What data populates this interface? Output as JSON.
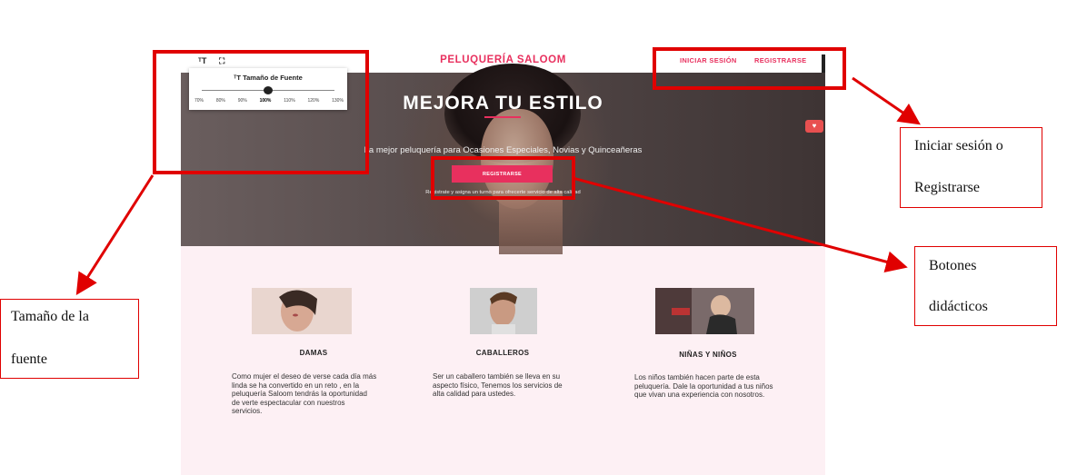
{
  "site": {
    "brand": "PELUQUERÍA SALOOM",
    "nav": {
      "login": "INICIAR SESIÓN",
      "register": "REGISTRARSE"
    },
    "toolbar": {
      "font_icon": "ᵀT",
      "fullscreen_icon": "⛶"
    },
    "font_popup": {
      "title": "Tamaño de Fuente",
      "title_icon": "ᵀT",
      "options": [
        "70%",
        "80%",
        "90%",
        "100%",
        "110%",
        "120%",
        "130%"
      ],
      "selected": "100%",
      "selected_index": 3
    },
    "hero": {
      "title": "MEJORA TU ESTILO",
      "subtitle": "La mejor peluquería para Ocasiones Especiales, Novias y Quinceañeras",
      "button": "REGISTRARSE",
      "note": "Registrate y asigna un turno para ofrecerte servicio de alta calidad"
    },
    "categories": [
      {
        "title": "DAMAS",
        "text": "Como mujer el deseo de verse cada día más linda se ha convertido en un reto , en la peluquería Saloom tendrás la oportunidad de verte espectacular con nuestros servicios."
      },
      {
        "title": "CABALLEROS",
        "text": "Ser un caballero también se lleva en su aspecto físico, Tenemos los servicios de alta calidad para ustedes."
      },
      {
        "title": "NIÑAS Y NIÑOS",
        "text": "Los niños también hacen parte de esta peluquería. Dale la oportunidad a tus niños que vivan una experiencia con nosotros."
      }
    ]
  },
  "annotations": {
    "login_label": [
      "Iniciar sesión o",
      "Registrarse"
    ],
    "buttons_label": [
      "Botones",
      "didácticos"
    ],
    "font_label": [
      "Tamaño de la",
      "fuente"
    ]
  },
  "colors": {
    "accent": "#e8305e",
    "annotation": "#e00000",
    "section_bg": "#fdf0f4"
  }
}
